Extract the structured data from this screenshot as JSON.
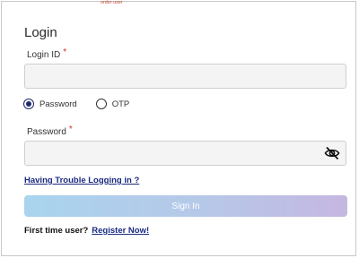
{
  "header": {
    "top_scrap": "order user"
  },
  "form": {
    "title": "Login",
    "login_id": {
      "label": "Login ID",
      "required_mark": "*",
      "value": "",
      "placeholder": ""
    },
    "auth_method": {
      "options": [
        {
          "label": "Password",
          "selected": true
        },
        {
          "label": "OTP",
          "selected": false
        }
      ]
    },
    "password": {
      "label": "Password",
      "required_mark": "*",
      "value": "",
      "placeholder": "",
      "toggle_icon": "eye-slash-icon"
    },
    "trouble_link": "Having Trouble Logging in ?",
    "sign_in_label": "Sign In",
    "first_time_text": "First time user?",
    "register_link": "Register Now!"
  },
  "colors": {
    "link": "#1a2a80",
    "required": "#d32f2f",
    "button_gradient_start": "#a9d4ee",
    "button_gradient_end": "#c5b7e1"
  }
}
